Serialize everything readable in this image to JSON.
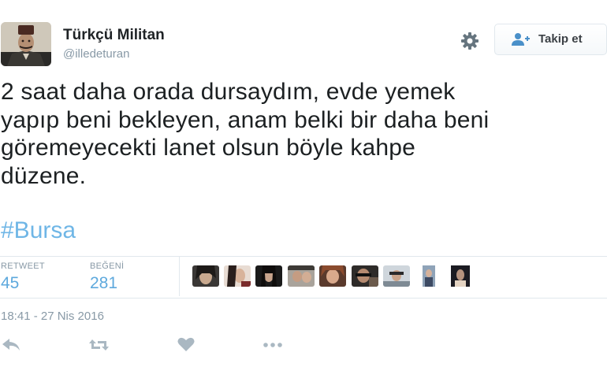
{
  "user": {
    "display_name": "Türkçü Militan",
    "handle": "@illedeturan",
    "avatar_icon": "profile-photo"
  },
  "header": {
    "settings_icon": "gear-icon",
    "follow_label": "Takip et",
    "follow_icon": "add-person-icon"
  },
  "tweet": {
    "text": "2 saat daha orada dursaydım, evde yemek\nyapıp beni bekleyen, anam belki bir daha beni\ngöremeyecekti lanet olsun böyle kahpe\ndüzene.",
    "hashtag": "#Bursa"
  },
  "stats": {
    "retweet_label": "RETWEET",
    "retweet_count": "45",
    "like_label": "BEĞENİ",
    "like_count": "281"
  },
  "liked_by_count": 9,
  "timestamp": "18:41 - 27 Nis 2016",
  "actions": [
    "reply-icon",
    "retweet-icon",
    "heart-icon",
    "more-icon"
  ],
  "colors": {
    "link": "#6fb6e6",
    "stat_value": "#5ea9dd",
    "muted": "#8899a6",
    "icon": "#aab8c2"
  }
}
